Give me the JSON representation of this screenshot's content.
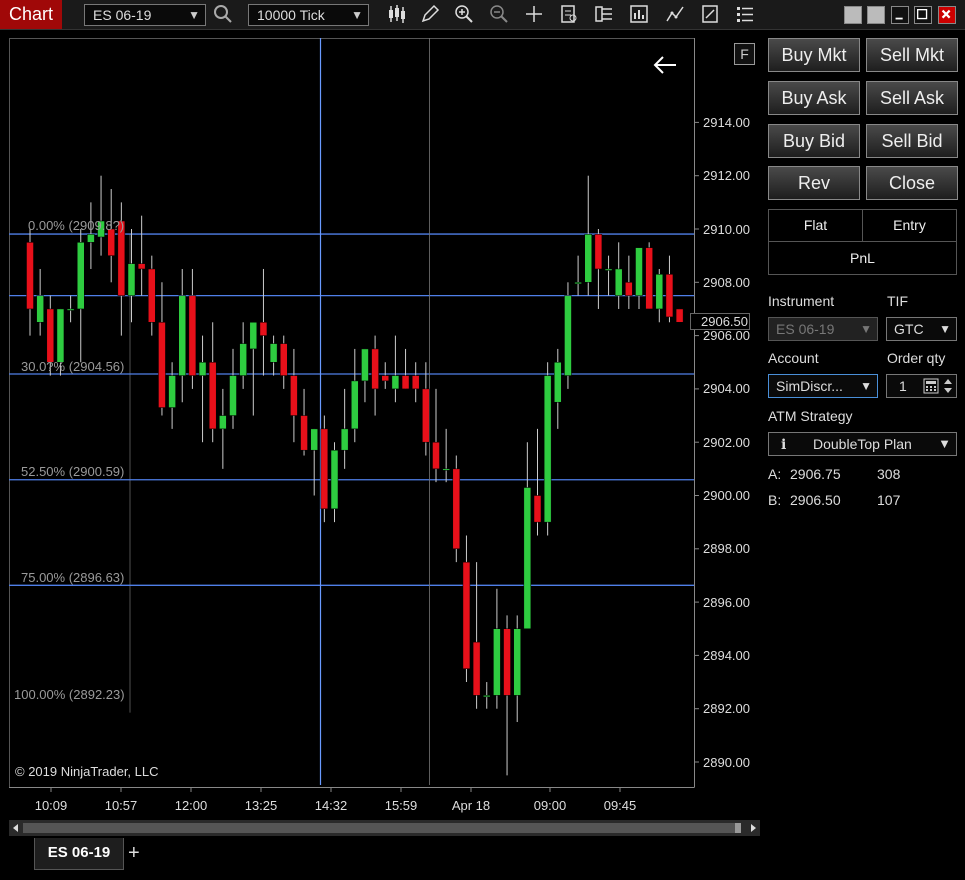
{
  "window": {
    "title": "Chart"
  },
  "toolbar": {
    "instrument": "ES 06-19",
    "interval": "10000 Tick"
  },
  "chart": {
    "fib_labels": [
      "0.00% (2909.8?)",
      "30.0?% (2904.56)",
      "52.50% (2900.59)",
      "75.00% (2896.63)",
      "100.00% (2892.23)"
    ],
    "price_labels": [
      "2914.00",
      "2912.00",
      "2910.00",
      "2908.00",
      "2906.00",
      "2904.00",
      "2902.00",
      "2900.00",
      "2898.00",
      "2896.00",
      "2894.00",
      "2892.00",
      "2890.00"
    ],
    "time_labels": [
      "10:09",
      "10:57",
      "12:00",
      "13:25",
      "14:32",
      "15:59",
      "Apr 18",
      "09:00",
      "09:45"
    ],
    "last_price": "2906.50",
    "f_button": "F",
    "copyright": "© 2019 NinjaTrader, LLC",
    "colors": {
      "up": "#2ecc40",
      "down": "#e8101a",
      "fib_line": "#4f7fe8",
      "crosshair": "#6a9aff"
    }
  },
  "chart_data": {
    "type": "candlestick",
    "ylim": [
      2889.5,
      2915.5
    ],
    "candles": [
      {
        "o": 2909.5,
        "h": 2910.0,
        "l": 2906.0,
        "c": 2907.0
      },
      {
        "o": 2906.5,
        "h": 2908.5,
        "l": 2906.0,
        "c": 2907.5
      },
      {
        "o": 2907.0,
        "h": 2907.5,
        "l": 2904.5,
        "c": 2905.0
      },
      {
        "o": 2905.0,
        "h": 2907.0,
        "l": 2904.5,
        "c": 2907.0
      },
      {
        "o": 2907.0,
        "h": 2907.5,
        "l": 2906.5,
        "c": 2907.0
      },
      {
        "o": 2907.0,
        "h": 2910.0,
        "l": 2905.0,
        "c": 2909.5
      },
      {
        "o": 2909.5,
        "h": 2911.0,
        "l": 2908.5,
        "c": 2909.8
      },
      {
        "o": 2909.7,
        "h": 2912.0,
        "l": 2909.0,
        "c": 2910.3
      },
      {
        "o": 2910.0,
        "h": 2911.5,
        "l": 2908.0,
        "c": 2909.0
      },
      {
        "o": 2910.3,
        "h": 2911.0,
        "l": 2906.0,
        "c": 2907.5
      },
      {
        "o": 2907.5,
        "h": 2910.0,
        "l": 2906.5,
        "c": 2908.7
      },
      {
        "o": 2908.7,
        "h": 2910.5,
        "l": 2907.5,
        "c": 2908.5
      },
      {
        "o": 2908.5,
        "h": 2909.0,
        "l": 2906.0,
        "c": 2906.5
      },
      {
        "o": 2906.5,
        "h": 2908.0,
        "l": 2903.0,
        "c": 2903.3
      },
      {
        "o": 2903.3,
        "h": 2905.0,
        "l": 2902.5,
        "c": 2904.5
      },
      {
        "o": 2904.5,
        "h": 2908.5,
        "l": 2903.5,
        "c": 2907.5
      },
      {
        "o": 2907.5,
        "h": 2908.5,
        "l": 2904.0,
        "c": 2904.5
      },
      {
        "o": 2904.5,
        "h": 2906.0,
        "l": 2902.0,
        "c": 2905.0
      },
      {
        "o": 2905.0,
        "h": 2906.5,
        "l": 2902.0,
        "c": 2902.5
      },
      {
        "o": 2902.5,
        "h": 2904.0,
        "l": 2901.0,
        "c": 2903.0
      },
      {
        "o": 2903.0,
        "h": 2905.5,
        "l": 2902.5,
        "c": 2904.5
      },
      {
        "o": 2904.5,
        "h": 2906.5,
        "l": 2904.0,
        "c": 2905.7
      },
      {
        "o": 2905.5,
        "h": 2906.5,
        "l": 2903.0,
        "c": 2906.5
      },
      {
        "o": 2906.5,
        "h": 2908.5,
        "l": 2904.5,
        "c": 2906.0
      },
      {
        "o": 2905.0,
        "h": 2906.0,
        "l": 2904.5,
        "c": 2905.7
      },
      {
        "o": 2905.7,
        "h": 2906.0,
        "l": 2904.0,
        "c": 2904.5
      },
      {
        "o": 2904.5,
        "h": 2905.5,
        "l": 2902.0,
        "c": 2903.0
      },
      {
        "o": 2903.0,
        "h": 2904.0,
        "l": 2901.5,
        "c": 2901.7
      },
      {
        "o": 2901.7,
        "h": 2902.5,
        "l": 2900.0,
        "c": 2902.5
      },
      {
        "o": 2902.5,
        "h": 2903.0,
        "l": 2899.0,
        "c": 2899.5
      },
      {
        "o": 2899.5,
        "h": 2902.0,
        "l": 2899.0,
        "c": 2901.7
      },
      {
        "o": 2901.7,
        "h": 2904.0,
        "l": 2901.0,
        "c": 2902.5
      },
      {
        "o": 2902.5,
        "h": 2905.5,
        "l": 2902.0,
        "c": 2904.3
      },
      {
        "o": 2904.3,
        "h": 2905.5,
        "l": 2903.5,
        "c": 2905.5
      },
      {
        "o": 2905.5,
        "h": 2906.0,
        "l": 2903.0,
        "c": 2904.0
      },
      {
        "o": 2904.5,
        "h": 2905.0,
        "l": 2904.0,
        "c": 2904.3
      },
      {
        "o": 2904.0,
        "h": 2906.0,
        "l": 2903.5,
        "c": 2904.5
      },
      {
        "o": 2904.5,
        "h": 2905.5,
        "l": 2904.0,
        "c": 2904.0
      },
      {
        "o": 2904.5,
        "h": 2905.0,
        "l": 2903.5,
        "c": 2904.0
      },
      {
        "o": 2904.0,
        "h": 2905.0,
        "l": 2901.5,
        "c": 2902.0
      },
      {
        "o": 2902.0,
        "h": 2904.0,
        "l": 2900.5,
        "c": 2901.0
      },
      {
        "o": 2901.0,
        "h": 2902.5,
        "l": 2900.5,
        "c": 2901.0
      },
      {
        "o": 2901.0,
        "h": 2901.5,
        "l": 2897.5,
        "c": 2898.0
      },
      {
        "o": 2897.5,
        "h": 2898.5,
        "l": 2893.0,
        "c": 2893.5
      },
      {
        "o": 2894.5,
        "h": 2897.5,
        "l": 2892.0,
        "c": 2892.5
      },
      {
        "o": 2892.5,
        "h": 2893.0,
        "l": 2892.0,
        "c": 2892.5
      },
      {
        "o": 2892.5,
        "h": 2896.5,
        "l": 2892.0,
        "c": 2895.0
      },
      {
        "o": 2895.0,
        "h": 2895.5,
        "l": 2889.5,
        "c": 2892.5
      },
      {
        "o": 2892.5,
        "h": 2895.5,
        "l": 2891.5,
        "c": 2895.0
      },
      {
        "o": 2895.0,
        "h": 2902.0,
        "l": 2895.0,
        "c": 2900.3
      },
      {
        "o": 2900.0,
        "h": 2902.5,
        "l": 2898.5,
        "c": 2899.0
      },
      {
        "o": 2899.0,
        "h": 2905.0,
        "l": 2898.5,
        "c": 2904.5
      },
      {
        "o": 2903.5,
        "h": 2905.5,
        "l": 2902.5,
        "c": 2905.0
      },
      {
        "o": 2904.5,
        "h": 2908.0,
        "l": 2904.0,
        "c": 2907.5
      },
      {
        "o": 2908.0,
        "h": 2909.0,
        "l": 2907.5,
        "c": 2908.0
      },
      {
        "o": 2908.0,
        "h": 2912.0,
        "l": 2907.5,
        "c": 2909.8
      },
      {
        "o": 2909.8,
        "h": 2910.0,
        "l": 2907.0,
        "c": 2908.5
      },
      {
        "o": 2908.5,
        "h": 2909.0,
        "l": 2907.5,
        "c": 2908.5
      },
      {
        "o": 2907.5,
        "h": 2909.5,
        "l": 2907.0,
        "c": 2908.5
      },
      {
        "o": 2908.0,
        "h": 2909.0,
        "l": 2907.0,
        "c": 2907.5
      },
      {
        "o": 2907.5,
        "h": 2909.0,
        "l": 2907.0,
        "c": 2909.3
      },
      {
        "o": 2909.3,
        "h": 2909.5,
        "l": 2907.0,
        "c": 2907.0
      },
      {
        "o": 2907.0,
        "h": 2908.5,
        "l": 2906.5,
        "c": 2908.3
      },
      {
        "o": 2908.3,
        "h": 2909.0,
        "l": 2906.5,
        "c": 2906.7
      },
      {
        "o": 2907.0,
        "h": 2907.0,
        "l": 2906.5,
        "c": 2906.5
      }
    ],
    "fib_levels": [
      2909.81,
      2904.56,
      2900.59,
      2896.63,
      2892.23
    ],
    "price_ticks": [
      2914,
      2912,
      2910,
      2908,
      2906,
      2904,
      2902,
      2900,
      2898,
      2896,
      2894,
      2892,
      2890
    ],
    "last_price": 2906.5
  },
  "order_panel": {
    "buttons": {
      "buy_mkt": "Buy Mkt",
      "sell_mkt": "Sell Mkt",
      "buy_ask": "Buy Ask",
      "sell_ask": "Sell Ask",
      "buy_bid": "Buy Bid",
      "sell_bid": "Sell Bid",
      "rev": "Rev",
      "close": "Close"
    },
    "position": {
      "flat": "Flat",
      "entry": "Entry",
      "pnl": "PnL"
    },
    "labels": {
      "instrument": "Instrument",
      "tif": "TIF",
      "account": "Account",
      "order_qty": "Order qty",
      "atm_strategy": "ATM Strategy"
    },
    "values": {
      "instrument": "ES 06-19",
      "tif": "GTC",
      "account": "SimDiscr...",
      "order_qty": "1",
      "atm_strategy": "DoubleTop Plan"
    },
    "quotes": {
      "a_label": "A:",
      "a_price": "2906.75",
      "a_size": "308",
      "b_label": "B:",
      "b_price": "2906.50",
      "b_size": "107"
    }
  },
  "tabs": {
    "active": "ES 06-19",
    "add": "+"
  }
}
